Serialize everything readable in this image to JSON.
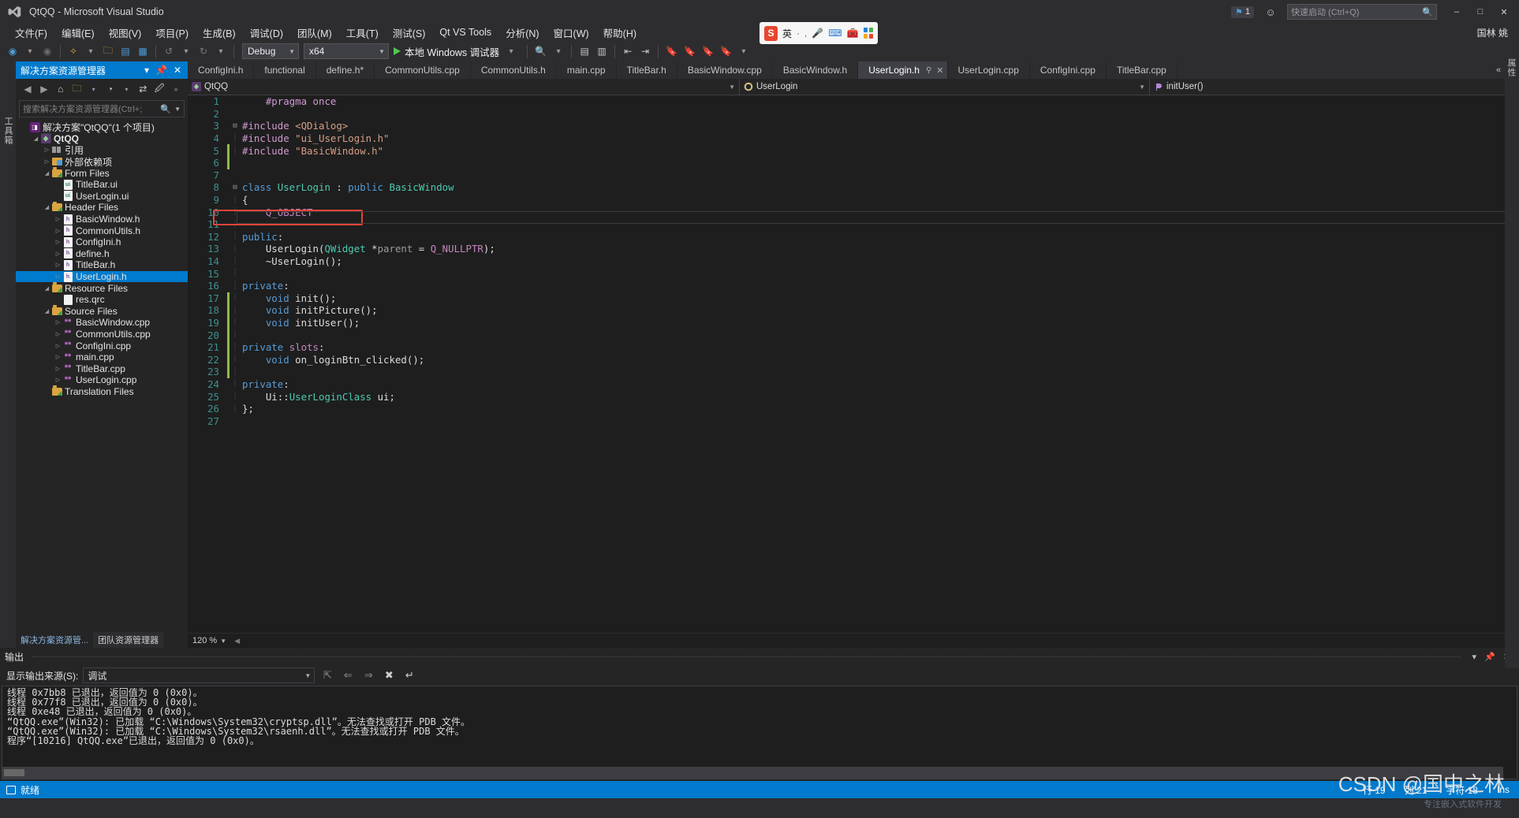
{
  "titlebar": {
    "title": "QtQQ - Microsoft Visual Studio",
    "logo_icon": "visual-studio-logo-icon",
    "notification_count": "1",
    "notification_icon": "flag-icon",
    "feedback_icon": "feedback-smiley-icon",
    "quick_launch_placeholder": "快速启动 (Ctrl+Q)",
    "quick_launch_icon": "magnifier-icon",
    "user_name": "国林 姚",
    "minimize": "–",
    "maximize": "□",
    "close": "✕"
  },
  "menubar": {
    "items": [
      {
        "text": "文件(F)",
        "key": "F"
      },
      {
        "text": "编辑(E)",
        "key": "E"
      },
      {
        "text": "视图(V)",
        "key": "V"
      },
      {
        "text": "项目(P)",
        "key": "P"
      },
      {
        "text": "生成(B)",
        "key": "B"
      },
      {
        "text": "调试(D)",
        "key": "D"
      },
      {
        "text": "团队(M)",
        "key": "M"
      },
      {
        "text": "工具(T)",
        "key": "T"
      },
      {
        "text": "测试(S)",
        "key": "S"
      },
      {
        "text": "Qt VS Tools",
        "key": ""
      },
      {
        "text": "分析(N)",
        "key": "N"
      },
      {
        "text": "窗口(W)",
        "key": "W"
      },
      {
        "text": "帮助(H)",
        "key": "H"
      }
    ]
  },
  "toolbar": {
    "nav_back_icon": "navigate-back-icon",
    "nav_forward_icon": "navigate-forward-icon",
    "new_project_icon": "new-project-icon",
    "open_file_icon": "open-file-icon",
    "save_icon": "save-icon",
    "save_all_icon": "save-all-icon",
    "undo_icon": "undo-icon",
    "redo_icon": "redo-icon",
    "config_value": "Debug",
    "platform_value": "x64",
    "run_label": "本地 Windows 调试器",
    "run_icon": "play-triangle-icon",
    "search_icon": "find-icon",
    "bookmark_icon": "bookmark-icon"
  },
  "float_search": {
    "logo_text": "S",
    "lang_label": "英",
    "dot_icon": "dot-icon",
    "mic_icon": "microphone-icon",
    "keyboard_icon": "keyboard-icon",
    "toolbox_icon": "toolbox-icon",
    "grid_icon": "app-grid-icon"
  },
  "left_strip": {
    "label": "工具箱"
  },
  "right_strip": {
    "label": "属性"
  },
  "solution_explorer": {
    "header_title": "解决方案资源管理器",
    "pin_icon": "pin-icon",
    "close_icon": "close-icon",
    "dropdown_icon": "chevron-down-icon",
    "toolbar_icons": [
      "back-icon",
      "forward-icon",
      "home-icon",
      "show-all-files-icon",
      "chevron-down-icon",
      "pending-changes-icon",
      "chevron-down-icon",
      "sync-icon",
      "properties-icon",
      "overflow-icon"
    ],
    "search_placeholder": "搜索解决方案资源管理器(Ctrl+;",
    "tree": [
      {
        "label": "解决方案\"QtQQ\"(1 个项目)",
        "indent": 0,
        "twisty": "",
        "icon": "solution-icon",
        "bold": false,
        "selected": false
      },
      {
        "label": "QtQQ",
        "indent": 1,
        "twisty": "◢",
        "icon": "qt-project-icon",
        "bold": true,
        "selected": false
      },
      {
        "label": "引用",
        "indent": 2,
        "twisty": "▷",
        "icon": "references-icon",
        "bold": false,
        "selected": false
      },
      {
        "label": "外部依赖项",
        "indent": 2,
        "twisty": "▷",
        "icon": "external-dependencies-icon",
        "bold": false,
        "selected": false
      },
      {
        "label": "Form Files",
        "indent": 2,
        "twisty": "◢",
        "icon": "qt-folder-icon",
        "bold": false,
        "selected": false
      },
      {
        "label": "TitleBar.ui",
        "indent": 3,
        "twisty": "",
        "icon": "ui-file-icon",
        "bold": false,
        "selected": false
      },
      {
        "label": "UserLogin.ui",
        "indent": 3,
        "twisty": "",
        "icon": "ui-file-icon",
        "bold": false,
        "selected": false
      },
      {
        "label": "Header Files",
        "indent": 2,
        "twisty": "◢",
        "icon": "qt-folder-icon",
        "bold": false,
        "selected": false
      },
      {
        "label": "BasicWindow.h",
        "indent": 3,
        "twisty": "▷",
        "icon": "header-file-icon",
        "bold": false,
        "selected": false
      },
      {
        "label": "CommonUtils.h",
        "indent": 3,
        "twisty": "▷",
        "icon": "header-file-icon",
        "bold": false,
        "selected": false
      },
      {
        "label": "ConfigIni.h",
        "indent": 3,
        "twisty": "▷",
        "icon": "header-file-icon",
        "bold": false,
        "selected": false
      },
      {
        "label": "define.h",
        "indent": 3,
        "twisty": "▷",
        "icon": "header-file-icon",
        "bold": false,
        "selected": false
      },
      {
        "label": "TitleBar.h",
        "indent": 3,
        "twisty": "▷",
        "icon": "header-file-icon",
        "bold": false,
        "selected": false
      },
      {
        "label": "UserLogin.h",
        "indent": 3,
        "twisty": "▷",
        "icon": "header-file-icon",
        "bold": false,
        "selected": true
      },
      {
        "label": "Resource Files",
        "indent": 2,
        "twisty": "◢",
        "icon": "qt-folder-icon",
        "bold": false,
        "selected": false
      },
      {
        "label": "res.qrc",
        "indent": 3,
        "twisty": "",
        "icon": "qrc-file-icon",
        "bold": false,
        "selected": false
      },
      {
        "label": "Source Files",
        "indent": 2,
        "twisty": "◢",
        "icon": "qt-folder-icon",
        "bold": false,
        "selected": false
      },
      {
        "label": "BasicWindow.cpp",
        "indent": 3,
        "twisty": "▷",
        "icon": "cpp-file-icon",
        "bold": false,
        "selected": false
      },
      {
        "label": "CommonUtils.cpp",
        "indent": 3,
        "twisty": "▷",
        "icon": "cpp-file-icon",
        "bold": false,
        "selected": false
      },
      {
        "label": "ConfigIni.cpp",
        "indent": 3,
        "twisty": "▷",
        "icon": "cpp-file-icon",
        "bold": false,
        "selected": false
      },
      {
        "label": "main.cpp",
        "indent": 3,
        "twisty": "▷",
        "icon": "cpp-file-icon",
        "bold": false,
        "selected": false
      },
      {
        "label": "TitleBar.cpp",
        "indent": 3,
        "twisty": "▷",
        "icon": "cpp-file-icon",
        "bold": false,
        "selected": false
      },
      {
        "label": "UserLogin.cpp",
        "indent": 3,
        "twisty": "▷",
        "icon": "cpp-file-icon",
        "bold": false,
        "selected": false
      },
      {
        "label": "Translation Files",
        "indent": 2,
        "twisty": "",
        "icon": "qt-folder-icon",
        "bold": false,
        "selected": false
      }
    ],
    "bottom_tabs": [
      {
        "label": "解决方案资源管...",
        "active": true
      },
      {
        "label": "团队资源管理器",
        "active": false
      }
    ]
  },
  "editor": {
    "tabs": [
      {
        "label": "ConfigIni.h",
        "active": false
      },
      {
        "label": "functional",
        "active": false
      },
      {
        "label": "define.h*",
        "active": false
      },
      {
        "label": "CommonUtils.cpp",
        "active": false
      },
      {
        "label": "CommonUtils.h",
        "active": false
      },
      {
        "label": "main.cpp",
        "active": false
      },
      {
        "label": "TitleBar.h",
        "active": false
      },
      {
        "label": "BasicWindow.cpp",
        "active": false
      },
      {
        "label": "BasicWindow.h",
        "active": false
      },
      {
        "label": "UserLogin.h",
        "active": true
      },
      {
        "label": "UserLogin.cpp",
        "active": false
      },
      {
        "label": "ConfigIni.cpp",
        "active": false
      },
      {
        "label": "TitleBar.cpp",
        "active": false
      }
    ],
    "tab_overflow_icon": "tab-overflow-icon",
    "tab_list_icon": "tab-list-icon",
    "navbar": {
      "project": "QtQQ",
      "project_icon": "qt-project-icon",
      "class": "UserLogin",
      "class_icon": "class-icon",
      "member": "initUser()",
      "member_icon": "method-icon"
    },
    "zoom": "120 %",
    "code": [
      {
        "n": "1",
        "change": false,
        "fold": "",
        "tokens": [
          {
            "t": "    ",
            "c": "pl"
          },
          {
            "t": "#pragma once",
            "c": "kp"
          }
        ]
      },
      {
        "n": "2",
        "change": false,
        "fold": "",
        "tokens": []
      },
      {
        "n": "3",
        "change": false,
        "fold": "-",
        "tokens": [
          {
            "t": "#include ",
            "c": "kp"
          },
          {
            "t": "<QDialog>",
            "c": "st"
          }
        ]
      },
      {
        "n": "4",
        "change": false,
        "fold": "|",
        "tokens": [
          {
            "t": "#include ",
            "c": "kp"
          },
          {
            "t": "\"ui_UserLogin.h\"",
            "c": "st"
          }
        ]
      },
      {
        "n": "5",
        "change": true,
        "fold": "|",
        "tokens": [
          {
            "t": "#include ",
            "c": "kp"
          },
          {
            "t": "\"BasicWindow.h\"",
            "c": "st"
          }
        ]
      },
      {
        "n": "6",
        "change": true,
        "fold": "",
        "tokens": []
      },
      {
        "n": "7",
        "change": false,
        "fold": "",
        "tokens": []
      },
      {
        "n": "8",
        "change": false,
        "fold": "-",
        "tokens": [
          {
            "t": "class ",
            "c": "k"
          },
          {
            "t": "UserLogin",
            "c": "ty"
          },
          {
            "t": " : ",
            "c": "pl"
          },
          {
            "t": "public ",
            "c": "k"
          },
          {
            "t": "BasicWindow",
            "c": "ty"
          }
        ]
      },
      {
        "n": "9",
        "change": false,
        "fold": "|",
        "tokens": [
          {
            "t": "{",
            "c": "pl"
          }
        ]
      },
      {
        "n": "10",
        "change": false,
        "fold": "|",
        "tokens": [
          {
            "t": "    ",
            "c": "pl"
          },
          {
            "t": "Q_OBJECT",
            "c": "mc"
          }
        ]
      },
      {
        "n": "11",
        "change": false,
        "fold": "|",
        "tokens": []
      },
      {
        "n": "12",
        "change": false,
        "fold": "|",
        "tokens": [
          {
            "t": "public",
            "c": "k"
          },
          {
            "t": ":",
            "c": "pl"
          }
        ]
      },
      {
        "n": "13",
        "change": false,
        "fold": "|",
        "tokens": [
          {
            "t": "    UserLogin(",
            "c": "pl"
          },
          {
            "t": "QWidget",
            "c": "ty"
          },
          {
            "t": " *",
            "c": "pl"
          },
          {
            "t": "parent",
            "c": "pm"
          },
          {
            "t": " = ",
            "c": "pl"
          },
          {
            "t": "Q_NULLPTR",
            "c": "mc"
          },
          {
            "t": ");",
            "c": "pl"
          }
        ]
      },
      {
        "n": "14",
        "change": false,
        "fold": "|",
        "tokens": [
          {
            "t": "    ~UserLogin();",
            "c": "pl"
          }
        ]
      },
      {
        "n": "15",
        "change": false,
        "fold": "|",
        "tokens": []
      },
      {
        "n": "16",
        "change": false,
        "fold": "|",
        "tokens": [
          {
            "t": "private",
            "c": "k"
          },
          {
            "t": ":",
            "c": "pl"
          }
        ]
      },
      {
        "n": "17",
        "change": true,
        "fold": "|",
        "tokens": [
          {
            "t": "    ",
            "c": "pl"
          },
          {
            "t": "void",
            "c": "k"
          },
          {
            "t": " init();",
            "c": "pl"
          }
        ]
      },
      {
        "n": "18",
        "change": true,
        "fold": "|",
        "tokens": [
          {
            "t": "    ",
            "c": "pl"
          },
          {
            "t": "void",
            "c": "k"
          },
          {
            "t": " initPicture();",
            "c": "pl"
          }
        ]
      },
      {
        "n": "19",
        "change": true,
        "fold": "|",
        "tokens": [
          {
            "t": "    ",
            "c": "pl"
          },
          {
            "t": "void",
            "c": "k"
          },
          {
            "t": " initUser();",
            "c": "pl"
          }
        ]
      },
      {
        "n": "20",
        "change": true,
        "fold": "|",
        "tokens": []
      },
      {
        "n": "21",
        "change": true,
        "fold": "|",
        "tokens": [
          {
            "t": "private ",
            "c": "k"
          },
          {
            "t": "slots",
            "c": "mc"
          },
          {
            "t": ":",
            "c": "pl"
          }
        ]
      },
      {
        "n": "22",
        "change": true,
        "fold": "|",
        "tokens": [
          {
            "t": "    ",
            "c": "pl"
          },
          {
            "t": "void",
            "c": "k"
          },
          {
            "t": " on_loginBtn_clicked();",
            "c": "pl"
          }
        ]
      },
      {
        "n": "23",
        "change": true,
        "fold": "|",
        "tokens": []
      },
      {
        "n": "24",
        "change": false,
        "fold": "|",
        "tokens": [
          {
            "t": "private",
            "c": "k"
          },
          {
            "t": ":",
            "c": "pl"
          }
        ]
      },
      {
        "n": "25",
        "change": false,
        "fold": "|",
        "tokens": [
          {
            "t": "    Ui::",
            "c": "pl"
          },
          {
            "t": "UserLoginClass",
            "c": "ty"
          },
          {
            "t": " ui;",
            "c": "pl"
          }
        ]
      },
      {
        "n": "26",
        "change": false,
        "fold": "|",
        "tokens": [
          {
            "t": "};",
            "c": "pl"
          }
        ]
      },
      {
        "n": "27",
        "change": false,
        "fold": "",
        "tokens": []
      }
    ]
  },
  "output": {
    "title": "输出",
    "dropdown_icon": "chevron-down-icon",
    "close_icon": "close-icon",
    "source_label": "显示输出来源(S):",
    "source_value": "调试",
    "toolbar_icons": [
      "find-message-icon",
      "go-to-previous-icon",
      "go-to-next-icon",
      "clear-all-icon",
      "word-wrap-icon"
    ],
    "lines": [
      "线程 0x7bb8 已退出，返回值为 0 (0x0)。",
      "线程 0x77f8 已退出，返回值为 0 (0x0)。",
      "线程 0xe48 已退出，返回值为 0 (0x0)。",
      "“QtQQ.exe”(Win32): 已加载 “C:\\Windows\\System32\\cryptsp.dll”。无法查找或打开 PDB 文件。",
      "“QtQQ.exe”(Win32): 已加载 “C:\\Windows\\System32\\rsaenh.dll”。无法查找或打开 PDB 文件。",
      "程序“[10216] QtQQ.exe”已退出，返回值为 0 (0x0)。"
    ]
  },
  "statusbar": {
    "status": "就绪",
    "status_icon": "ready-icon",
    "line_label": "行 19",
    "col_label": "列 21",
    "char_label": "字符 18",
    "insert_label": "Ins"
  },
  "watermark": {
    "main": "CSDN @国中之林",
    "sub": "专注嵌入式软件开发"
  },
  "colors": {
    "accent": "#007acc",
    "chrome": "#2d2d30",
    "panel": "#252526",
    "editor_bg": "#1e1e1e",
    "highlight_box": "#e8433a",
    "change_bar": "#8fbc46"
  }
}
